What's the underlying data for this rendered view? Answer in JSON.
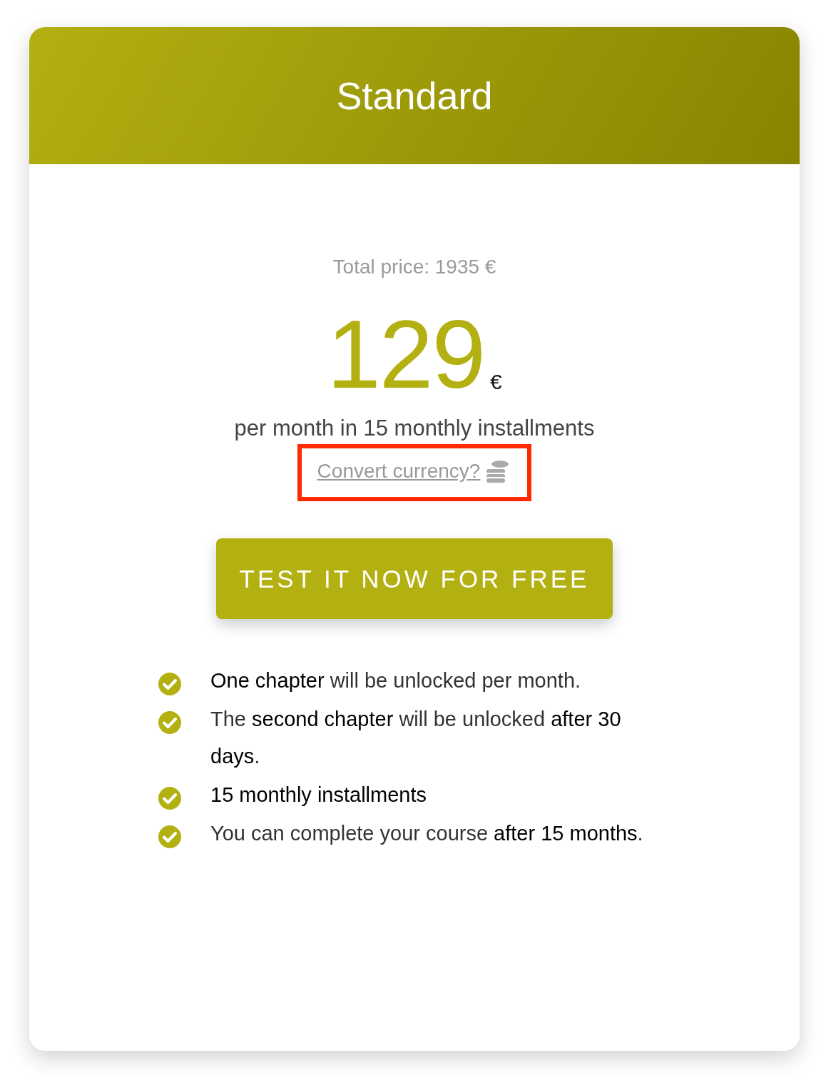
{
  "plan": {
    "title": "Standard"
  },
  "total_price": "Total price: 1935 €",
  "price": {
    "amount": "129",
    "currency": "€",
    "period": "per month in 15 monthly installments"
  },
  "convert_link": {
    "label": "Convert currency?",
    "highlighted": true
  },
  "cta_button": "TEST IT NOW FOR FREE",
  "features": [
    {
      "text": "**One chapter** will be unlocked per month."
    },
    {
      "text": "The **second chapter** will be unlocked **after 30 days**."
    },
    {
      "text": "**15 monthly installments**"
    },
    {
      "text": "You can complete your course **after 15 months**."
    }
  ]
}
